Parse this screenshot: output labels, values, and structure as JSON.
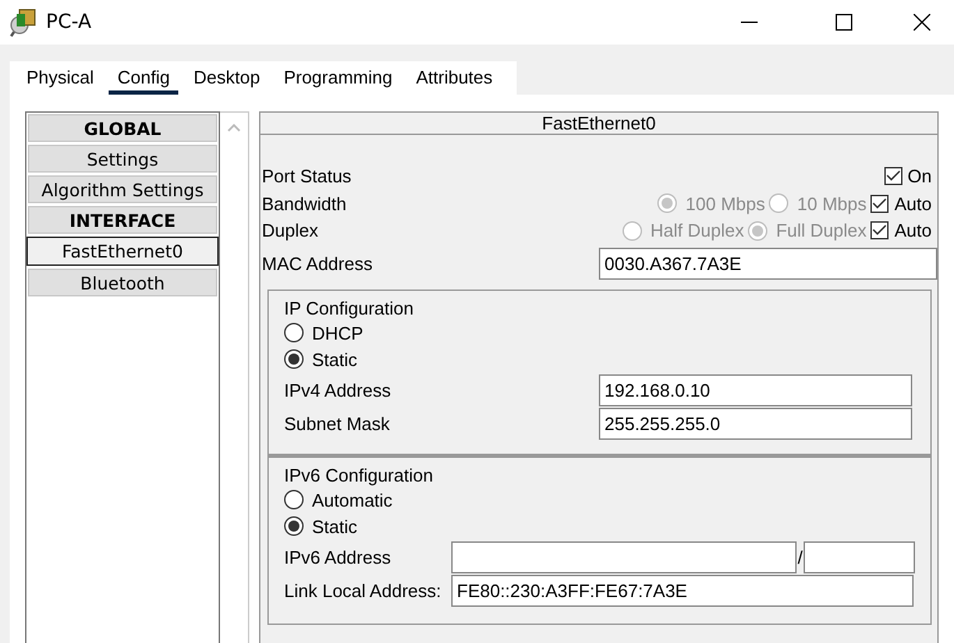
{
  "window": {
    "title": "PC-A"
  },
  "tabs": [
    {
      "label": "Physical",
      "selected": false
    },
    {
      "label": "Config",
      "selected": true
    },
    {
      "label": "Desktop",
      "selected": false
    },
    {
      "label": "Programming",
      "selected": false
    },
    {
      "label": "Attributes",
      "selected": false
    }
  ],
  "sidebar": {
    "items": [
      {
        "label": "GLOBAL",
        "kind": "header",
        "selected": false
      },
      {
        "label": "Settings",
        "kind": "item",
        "selected": false
      },
      {
        "label": "Algorithm Settings",
        "kind": "item",
        "selected": false
      },
      {
        "label": "INTERFACE",
        "kind": "header",
        "selected": false
      },
      {
        "label": "FastEthernet0",
        "kind": "item",
        "selected": true
      },
      {
        "label": "Bluetooth",
        "kind": "item",
        "selected": false
      }
    ]
  },
  "panel": {
    "title": "FastEthernet0",
    "port_status": {
      "label": "Port Status",
      "toggle": {
        "label": "On",
        "checked": true
      }
    },
    "bandwidth": {
      "label": "Bandwidth",
      "options": [
        {
          "label": "100 Mbps",
          "selected": true,
          "disabled": true
        },
        {
          "label": "10 Mbps",
          "selected": false,
          "disabled": true
        }
      ],
      "auto": {
        "label": "Auto",
        "checked": true
      }
    },
    "duplex": {
      "label": "Duplex",
      "options": [
        {
          "label": "Half Duplex",
          "selected": false,
          "disabled": true
        },
        {
          "label": "Full Duplex",
          "selected": true,
          "disabled": true
        }
      ],
      "auto": {
        "label": "Auto",
        "checked": true
      }
    },
    "mac": {
      "label": "MAC Address",
      "value": "0030.A367.7A3E"
    },
    "ip_config": {
      "title": "IP Configuration",
      "modes": [
        {
          "label": "DHCP",
          "selected": false
        },
        {
          "label": "Static",
          "selected": true
        }
      ],
      "fields": [
        {
          "label": "IPv4 Address",
          "value": "192.168.0.10"
        },
        {
          "label": "Subnet Mask",
          "value": "255.255.255.0"
        }
      ]
    },
    "ipv6_config": {
      "title": "IPv6 Configuration",
      "modes": [
        {
          "label": "Automatic",
          "selected": false
        },
        {
          "label": "Static",
          "selected": true
        }
      ],
      "address": {
        "label": "IPv6 Address",
        "separator": "/"
      },
      "link_local": {
        "label": "Link Local Address:",
        "value": "FE80::230:A3FF:FE67:7A3E"
      }
    }
  }
}
